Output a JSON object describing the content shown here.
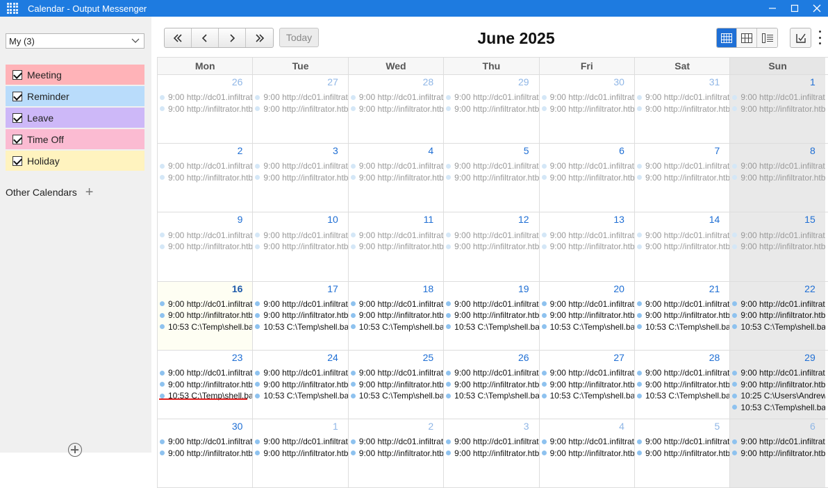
{
  "window": {
    "title": "Calendar - Output Messenger",
    "icons": {
      "app": "grid-icon",
      "minimize": "minimize-icon",
      "maximize": "maximize-icon",
      "close": "close-icon"
    }
  },
  "sidebar": {
    "calendar_select": "My (3)",
    "types": [
      {
        "label": "Meeting",
        "color": "#ffb3b8",
        "checked": true
      },
      {
        "label": "Reminder",
        "color": "#b9dcfb",
        "checked": true
      },
      {
        "label": "Leave",
        "color": "#cdb8f8",
        "checked": true
      },
      {
        "label": "Time Off",
        "color": "#fbbbd2",
        "checked": true
      },
      {
        "label": "Holiday",
        "color": "#fff3bf",
        "checked": true
      }
    ],
    "other_calendars": "Other Calendars"
  },
  "toolbar": {
    "today_label": "Today",
    "month_title": "June 2025"
  },
  "calendar": {
    "days_of_week": [
      "Mon",
      "Tue",
      "Wed",
      "Thu",
      "Fri",
      "Sat",
      "Sun"
    ],
    "weeks": [
      [
        {
          "day": "26",
          "other": true,
          "events": [
            "9:00 http://dc01.infiltrat",
            "9:00 http://infiltrator.htb"
          ]
        },
        {
          "day": "27",
          "other": true,
          "events": [
            "9:00 http://dc01.infiltrat",
            "9:00 http://infiltrator.htb"
          ]
        },
        {
          "day": "28",
          "other": true,
          "events": [
            "9:00 http://dc01.infiltrat",
            "9:00 http://infiltrator.htb"
          ]
        },
        {
          "day": "29",
          "other": true,
          "events": [
            "9:00 http://dc01.infiltrat",
            "9:00 http://infiltrator.htb"
          ]
        },
        {
          "day": "30",
          "other": true,
          "events": [
            "9:00 http://dc01.infiltrat",
            "9:00 http://infiltrator.htb"
          ]
        },
        {
          "day": "31",
          "other": true,
          "events": [
            "9:00 http://dc01.infiltrat",
            "9:00 http://infiltrator.htb"
          ]
        },
        {
          "day": "1",
          "other": false,
          "sun": true,
          "events": [
            "9:00 http://dc01.infiltrat",
            "9:00 http://infiltrator.htb"
          ],
          "muted": true
        }
      ],
      [
        {
          "day": "2",
          "events": [
            "9:00 http://dc01.infiltrat",
            "9:00 http://infiltrator.htb"
          ],
          "muted": true
        },
        {
          "day": "3",
          "events": [
            "9:00 http://dc01.infiltrat",
            "9:00 http://infiltrator.htb"
          ],
          "muted": true
        },
        {
          "day": "4",
          "events": [
            "9:00 http://dc01.infiltrat",
            "9:00 http://infiltrator.htb"
          ],
          "muted": true
        },
        {
          "day": "5",
          "events": [
            "9:00 http://dc01.infiltrat",
            "9:00 http://infiltrator.htb"
          ],
          "muted": true
        },
        {
          "day": "6",
          "events": [
            "9:00 http://dc01.infiltrat",
            "9:00 http://infiltrator.htb"
          ],
          "muted": true
        },
        {
          "day": "7",
          "events": [
            "9:00 http://dc01.infiltrat",
            "9:00 http://infiltrator.htb"
          ],
          "muted": true
        },
        {
          "day": "8",
          "sun": true,
          "events": [
            "9:00 http://dc01.infiltrat",
            "9:00 http://infiltrator.htb"
          ],
          "muted": true
        }
      ],
      [
        {
          "day": "9",
          "events": [
            "9:00 http://dc01.infiltrat",
            "9:00 http://infiltrator.htb"
          ],
          "muted": true
        },
        {
          "day": "10",
          "events": [
            "9:00 http://dc01.infiltrat",
            "9:00 http://infiltrator.htb"
          ],
          "muted": true
        },
        {
          "day": "11",
          "events": [
            "9:00 http://dc01.infiltrat",
            "9:00 http://infiltrator.htb"
          ],
          "muted": true
        },
        {
          "day": "12",
          "events": [
            "9:00 http://dc01.infiltrat",
            "9:00 http://infiltrator.htb"
          ],
          "muted": true
        },
        {
          "day": "13",
          "events": [
            "9:00 http://dc01.infiltrat",
            "9:00 http://infiltrator.htb"
          ],
          "muted": true
        },
        {
          "day": "14",
          "events": [
            "9:00 http://dc01.infiltrat",
            "9:00 http://infiltrator.htb"
          ],
          "muted": true
        },
        {
          "day": "15",
          "sun": true,
          "events": [
            "9:00 http://dc01.infiltrat",
            "9:00 http://infiltrator.htb"
          ],
          "muted": true
        }
      ],
      [
        {
          "day": "16",
          "today": true,
          "events": [
            "9:00 http://dc01.infiltrat",
            "9:00 http://infiltrator.htb",
            "10:53 C:\\Temp\\shell.ba"
          ]
        },
        {
          "day": "17",
          "events": [
            "9:00 http://dc01.infiltrat",
            "9:00 http://infiltrator.htb",
            "10:53 C:\\Temp\\shell.ba"
          ]
        },
        {
          "day": "18",
          "events": [
            "9:00 http://dc01.infiltrat",
            "9:00 http://infiltrator.htb",
            "10:53 C:\\Temp\\shell.ba"
          ]
        },
        {
          "day": "19",
          "events": [
            "9:00 http://dc01.infiltrat",
            "9:00 http://infiltrator.htb",
            "10:53 C:\\Temp\\shell.ba"
          ]
        },
        {
          "day": "20",
          "events": [
            "9:00 http://dc01.infiltrat",
            "9:00 http://infiltrator.htb",
            "10:53 C:\\Temp\\shell.ba"
          ]
        },
        {
          "day": "21",
          "events": [
            "9:00 http://dc01.infiltrat",
            "9:00 http://infiltrator.htb",
            "10:53 C:\\Temp\\shell.ba"
          ]
        },
        {
          "day": "22",
          "sun": true,
          "events": [
            "9:00 http://dc01.infiltrat",
            "9:00 http://infiltrator.htb",
            "10:53 C:\\Temp\\shell.ba"
          ]
        }
      ],
      [
        {
          "day": "23",
          "events": [
            "9:00 http://dc01.infiltrat",
            "9:00 http://infiltrator.htb",
            "10:53 C:\\Temp\\shell.ba"
          ]
        },
        {
          "day": "24",
          "events": [
            "9:00 http://dc01.infiltrat",
            "9:00 http://infiltrator.htb",
            "10:53 C:\\Temp\\shell.ba"
          ]
        },
        {
          "day": "25",
          "events": [
            "9:00 http://dc01.infiltrat",
            "9:00 http://infiltrator.htb",
            "10:53 C:\\Temp\\shell.ba"
          ]
        },
        {
          "day": "26",
          "events": [
            "9:00 http://dc01.infiltrat",
            "9:00 http://infiltrator.htb",
            "10:53 C:\\Temp\\shell.ba"
          ]
        },
        {
          "day": "27",
          "events": [
            "9:00 http://dc01.infiltrat",
            "9:00 http://infiltrator.htb",
            "10:53 C:\\Temp\\shell.ba"
          ]
        },
        {
          "day": "28",
          "events": [
            "9:00 http://dc01.infiltrat",
            "9:00 http://infiltrator.htb",
            "10:53 C:\\Temp\\shell.ba"
          ]
        },
        {
          "day": "29",
          "sun": true,
          "events": [
            "9:00 http://dc01.infiltrat",
            "9:00 http://infiltrator.htb",
            "10:25 C:\\Users\\Andrew",
            "10:53 C:\\Temp\\shell.ba"
          ]
        }
      ],
      [
        {
          "day": "30",
          "events": [
            "9:00 http://dc01.infiltrat",
            "9:00 http://infiltrator.htb"
          ]
        },
        {
          "day": "1",
          "other": true,
          "events": [
            "9:00 http://dc01.infiltrat",
            "9:00 http://infiltrator.htb"
          ],
          "dark": true
        },
        {
          "day": "2",
          "other": true,
          "events": [
            "9:00 http://dc01.infiltrat",
            "9:00 http://infiltrator.htb"
          ],
          "dark": true
        },
        {
          "day": "3",
          "other": true,
          "events": [
            "9:00 http://dc01.infiltrat",
            "9:00 http://infiltrator.htb"
          ],
          "dark": true
        },
        {
          "day": "4",
          "other": true,
          "events": [
            "9:00 http://dc01.infiltrat",
            "9:00 http://infiltrator.htb"
          ],
          "dark": true
        },
        {
          "day": "5",
          "other": true,
          "events": [
            "9:00 http://dc01.infiltrat",
            "9:00 http://infiltrator.htb"
          ],
          "dark": true
        },
        {
          "day": "6",
          "other": true,
          "sun": true,
          "events": [
            "9:00 http://dc01.infiltrat",
            "9:00 http://infiltrator.htb"
          ],
          "dark": true
        }
      ]
    ]
  }
}
